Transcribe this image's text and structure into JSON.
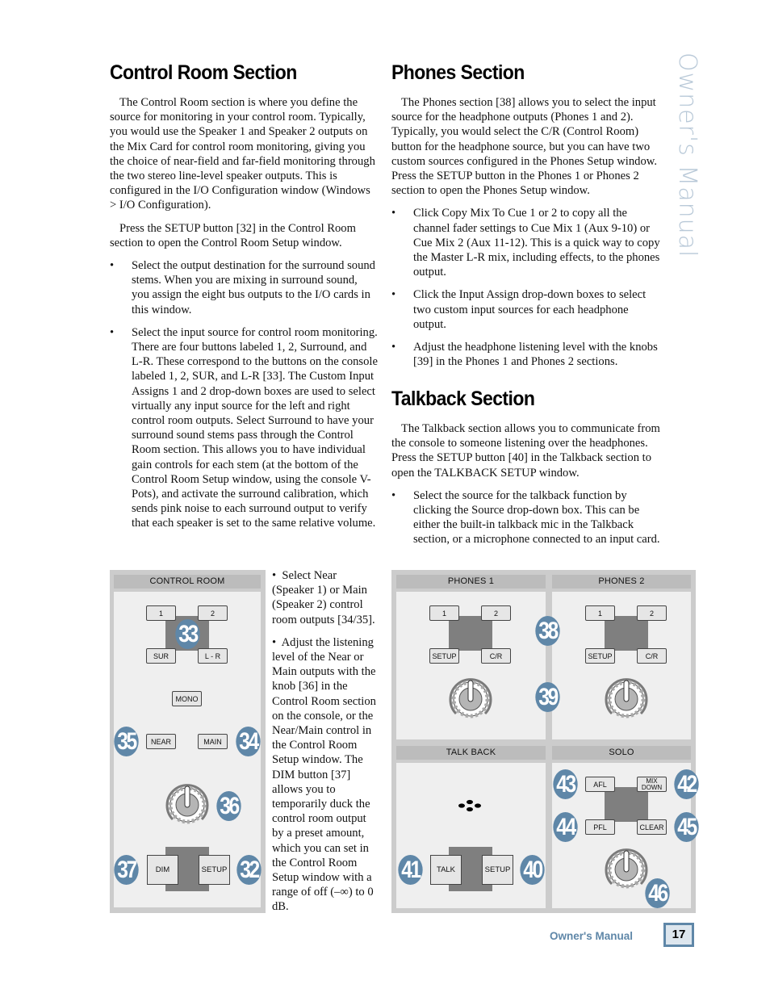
{
  "sidebar_title": "Owner's Manual",
  "control_room": {
    "heading": "Control Room Section",
    "paragraphs": [
      "The Control Room section is where you define the source for monitoring in your control room. Typically, you would use the Speaker 1 and Speaker 2 outputs on the Mix Card for control room monitoring, giving you the choice of near-field and far-field monitoring through the two stereo line-level speaker outputs. This is configured in the I/O Configuration window (Windows > I/O Configuration).",
      "Press the SETUP button [32] in the Control Room section to open the Control Room Setup window."
    ],
    "bullets": [
      "Select the output destination for the surround sound stems. When you are mixing in surround sound, you assign the eight bus outputs to the I/O cards in this window.",
      "Select the input source for control room monitoring. There are four buttons labeled 1, 2, Surround, and L-R. These correspond to the buttons on the console labeled 1, 2, SUR, and L-R [33]. The Custom Input Assigns 1 and 2 drop-down boxes are used to select virtually any input source for the left and right control room outputs. Select Surround to have your surround sound stems pass through the Control Room section. This allows you to have individual gain controls for each stem (at the bottom of the Control Room Setup window, using the console V-Pots), and activate the surround calibration, which sends pink noise to each surround output to verify that each speaker is set to the same relative volume."
    ],
    "side_bullets": [
      "Select Near (Speaker 1) or Main (Speaker 2) control room outputs [34/35].",
      "Adjust the listening level of the Near or Main outputs with the knob [36] in the Control Room section on the console, or the Near/Main control in the Control Room Setup window. The DIM button [37] allows you to temporarily duck the control room output by a preset amount, which you can set in the Control Room Setup window with a range of off (–∞) to 0 dB."
    ],
    "bullet_char": "•"
  },
  "phones": {
    "heading": "Phones Section",
    "paragraphs": [
      "The Phones section [38] allows you to select the input source for the headphone outputs (Phones 1 and 2). Typically, you would select the C/R (Control Room) button for the headphone source, but you can have two custom sources configured in the Phones Setup window. Press the SETUP button in the Phones 1 or Phones 2 section to open the Phones Setup window."
    ],
    "bullets": [
      "Click Copy Mix To Cue 1 or 2 to copy all the channel fader settings to Cue Mix 1 (Aux 9-10) or Cue Mix 2 (Aux 11-12). This is a quick way to copy the Master L-R mix, including effects, to the phones output.",
      "Click the Input Assign drop-down boxes to select two custom input sources for each headphone output.",
      "Adjust the headphone listening level with the knobs [39] in the Phones 1 and Phones 2 sections."
    ]
  },
  "talkback": {
    "heading": "Talkback Section",
    "paragraphs": [
      "The Talkback section allows you to communicate from the console to someone listening over the headphones. Press the SETUP button [40] in the Talkback section to open the TALKBACK SETUP window."
    ],
    "bullets": [
      "Select the source for the talkback function by clicking the Source drop-down box. This can be either the built-in talkback mic in the Talkback section, or a microphone connected to an input card."
    ]
  },
  "diagram_control_room": {
    "title": "CONTROL ROOM",
    "buttons": {
      "b1": "1",
      "b2": "2",
      "sur": "SUR",
      "lr": "L - R",
      "mono": "MONO",
      "near": "NEAR",
      "main": "MAIN",
      "dim": "DIM",
      "setup": "SETUP"
    },
    "callouts": {
      "source": "33",
      "near": "35",
      "main": "34",
      "knob": "36",
      "dim": "37",
      "setup": "32"
    }
  },
  "diagram_phones": {
    "phones1_title": "PHONES 1",
    "phones2_title": "PHONES 2",
    "buttons": {
      "b1": "1",
      "b2": "2",
      "setup": "SETUP",
      "cr": "C/R"
    },
    "callouts": {
      "source": "38",
      "knob": "39"
    }
  },
  "diagram_talkback": {
    "title": "TALK BACK",
    "buttons": {
      "talk": "TALK",
      "setup": "SETUP"
    },
    "callouts": {
      "talk": "41",
      "setup": "40"
    }
  },
  "diagram_solo": {
    "title": "SOLO",
    "buttons": {
      "afl": "AFL",
      "mixdown": "MIX DOWN",
      "pfl": "PFL",
      "clear": "CLEAR"
    },
    "callouts": {
      "afl": "43",
      "mixdown": "42",
      "pfl": "44",
      "clear": "45",
      "knob": "46"
    }
  },
  "footer": {
    "label": "Owner's Manual",
    "page": "17"
  },
  "colors": {
    "accent": "#5f87a8",
    "panel": "#cccccc",
    "header": "#bcbcbc",
    "subpanel": "#efefef",
    "block": "#7f7f7f"
  }
}
